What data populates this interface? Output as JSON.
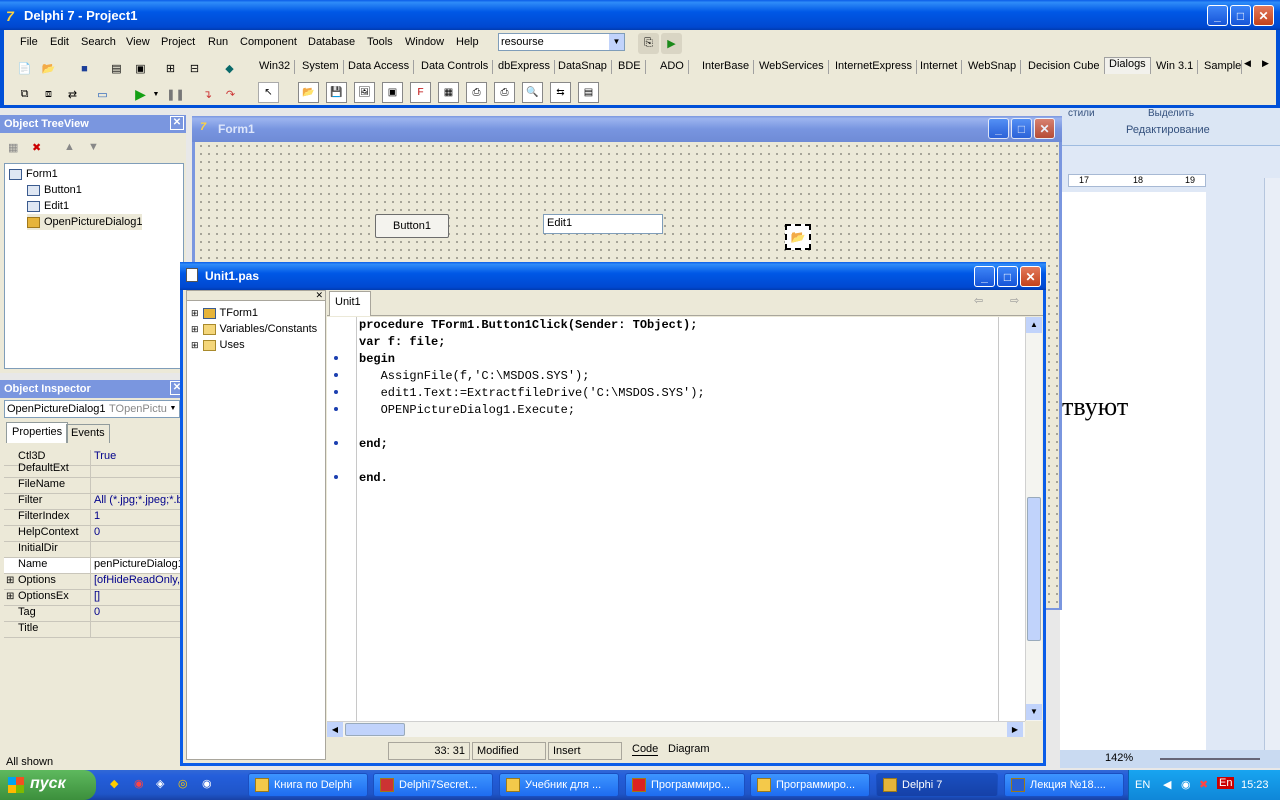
{
  "ide": {
    "title": "Delphi 7 - Project1",
    "menu": [
      "File",
      "Edit",
      "Search",
      "View",
      "Project",
      "Run",
      "Component",
      "Database",
      "Tools",
      "Window",
      "Help"
    ],
    "config_combo": "resourse",
    "palette_tabs": [
      "Win32",
      "System",
      "Data Access",
      "Data Controls",
      "dbExpress",
      "DataSnap",
      "BDE",
      "ADO",
      "InterBase",
      "WebServices",
      "InternetExpress",
      "Internet",
      "WebSnap",
      "Decision Cube",
      "Dialogs",
      "Win 3.1",
      "Sample"
    ]
  },
  "treeview": {
    "title": "Object TreeView",
    "items": [
      "Form1",
      "Button1",
      "Edit1",
      "OpenPictureDialog1"
    ]
  },
  "inspector": {
    "title": "Object Inspector",
    "selected_object": "OpenPictureDialog1",
    "selected_type": "TOpenPictur",
    "tabs": [
      "Properties",
      "Events"
    ],
    "props": [
      {
        "name": "Ctl3D",
        "value": "True"
      },
      {
        "name": "DefaultExt",
        "value": ""
      },
      {
        "name": "FileName",
        "value": ""
      },
      {
        "name": "Filter",
        "value": "All (*.jpg;*.jpeg;*.br"
      },
      {
        "name": "FilterIndex",
        "value": "1"
      },
      {
        "name": "HelpContext",
        "value": "0"
      },
      {
        "name": "InitialDir",
        "value": ""
      },
      {
        "name": "Name",
        "value": "penPictureDialog1"
      },
      {
        "name": "Options",
        "value": "[ofHideReadOnly,o"
      },
      {
        "name": "OptionsEx",
        "value": "[]"
      },
      {
        "name": "Tag",
        "value": "0"
      },
      {
        "name": "Title",
        "value": ""
      }
    ],
    "status": "All shown"
  },
  "form": {
    "title": "Form1",
    "button_caption": "Button1",
    "edit_text": "Edit1"
  },
  "editor": {
    "title": "Unit1.pas",
    "explorer_items": [
      "TForm1",
      "Variables/Constants",
      "Uses"
    ],
    "tab": "Unit1",
    "code": [
      "procedure TForm1.Button1Click(Sender: TObject);",
      "var f: file;",
      "begin",
      "   AssignFile(f,'C:\\MSDOS.SYS');",
      "   edit1.Text:=ExtractfileDrive('C:\\MSDOS.SYS');",
      "   OPENPictureDialog1.Execute;",
      "",
      "end;",
      "",
      "end."
    ],
    "status_pos": "33:  31",
    "status_modified": "Modified",
    "status_insert": "Insert",
    "view_tabs": [
      "Code",
      "Diagram"
    ]
  },
  "word_bg": {
    "ribbon_label1": "стили",
    "ribbon_label2": "Выделить",
    "ribbon_group": "Редактирование",
    "ruler": [
      "17",
      "18",
      "19"
    ],
    "doc_text": "твуют",
    "zoom": "142%"
  },
  "taskbar": {
    "start": "пуск",
    "tasks": [
      "Книга по Delphi",
      "Delphi7Secret...",
      "Учебник для ...",
      "Программиро...",
      "Программиро...",
      "Delphi 7",
      "Лекция №18...."
    ],
    "lang": "EN",
    "clock": "15:23"
  }
}
